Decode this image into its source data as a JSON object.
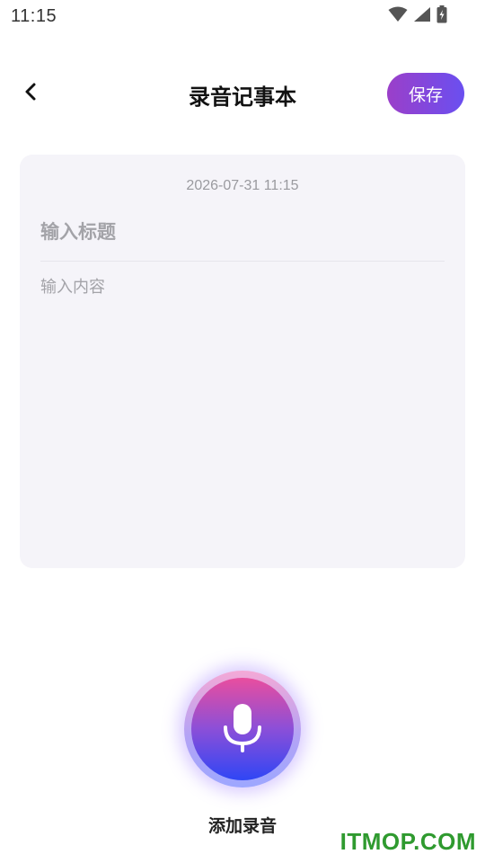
{
  "status_bar": {
    "time": "11:15",
    "icons": [
      "wifi-icon",
      "cell-signal-icon",
      "battery-icon"
    ]
  },
  "header": {
    "back_icon": "chevron-left-icon",
    "title": "录音记事本",
    "save_label": "保存"
  },
  "note": {
    "date": "2026-07-31 11:15",
    "title_placeholder": "输入标题",
    "title_value": "",
    "content_placeholder": "输入内容",
    "content_value": ""
  },
  "record": {
    "icon": "microphone-icon",
    "label": "添加录音"
  },
  "watermark": "ITMOP.COM",
  "colors": {
    "accent_start": "#9b3fc9",
    "accent_end": "#6a4ff0",
    "card_bg": "#f5f4f9",
    "watermark": "#2f9a2f"
  }
}
